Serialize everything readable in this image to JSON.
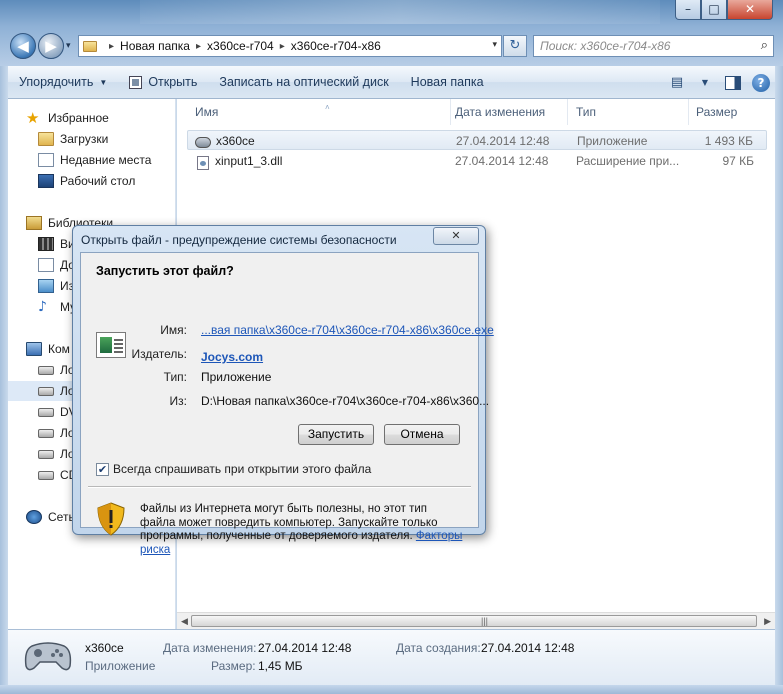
{
  "window": {
    "min_label": "–",
    "max_label": "□",
    "close_label": "✕"
  },
  "nav": {
    "back": "◀",
    "forward": "▶",
    "dropdown": "▾"
  },
  "address": {
    "crumbs": [
      "Новая папка",
      "x360ce-r704",
      "x360ce-r704-x86"
    ],
    "separator": "▸",
    "dropdown": "▾"
  },
  "refresh_icon": "↻",
  "search": {
    "placeholder": "Поиск: x360ce-r704-x86",
    "icon": "⌕"
  },
  "toolbar": {
    "organize": "Упорядочить",
    "open": "Открыть",
    "burn": "Записать на оптический диск",
    "new_folder": "Новая папка",
    "caret": "▼",
    "view_icon": "▤",
    "help": "?"
  },
  "sidebar": {
    "favorites": {
      "label": "Избранное",
      "items": [
        "Загрузки",
        "Недавние места",
        "Рабочий стол"
      ]
    },
    "libraries": {
      "label": "Библиотеки",
      "items": [
        "Ви",
        "До",
        "Из",
        "Му"
      ]
    },
    "computer": {
      "label": "Ком",
      "items": [
        "Ло",
        "Ло",
        "DV",
        "Ло",
        "Ло",
        "CD"
      ]
    },
    "network": {
      "label": "Сеть"
    }
  },
  "columns": {
    "name": "Имя",
    "date": "Дата изменения",
    "type": "Тип",
    "size": "Размер",
    "sort_arrow": "˄"
  },
  "files": [
    {
      "name": "x360ce",
      "date": "27.04.2014 12:48",
      "type": "Приложение",
      "size": "1 493 КБ"
    },
    {
      "name": "xinput1_3.dll",
      "date": "27.04.2014 12:48",
      "type": "Расширение при...",
      "size": "97 КБ"
    }
  ],
  "scroll": {
    "left": "◀",
    "right": "▶",
    "grip": "|||"
  },
  "details": {
    "name": "x360ce",
    "kind": "Приложение",
    "modified_label": "Дата изменения:",
    "modified_value": "27.04.2014 12:48",
    "size_label": "Размер:",
    "size_value": "1,45 МБ",
    "created_label": "Дата создания:",
    "created_value": "27.04.2014 12:48"
  },
  "dialog": {
    "title": "Открыть файл - предупреждение системы безопасности",
    "close": "✕",
    "heading": "Запустить этот файл?",
    "name_label": "Имя:",
    "name_value": "...вая папка\\x360ce-r704\\x360ce-r704-x86\\x360ce.exe",
    "publisher_label": "Издатель:",
    "publisher_value": "Jocys.com",
    "type_label": "Тип:",
    "type_value": "Приложение",
    "from_label": "Из:",
    "from_value": "D:\\Новая папка\\x360ce-r704\\x360ce-r704-x86\\x360...",
    "run_button": "Запустить",
    "cancel_button": "Отмена",
    "always_ask": "Всегда спрашивать при открытии этого файла",
    "always_ask_checked": true,
    "check_mark": "✔",
    "warning_text": "Файлы из Интернета могут быть полезны, но этот тип файла может повредить компьютер. Запускайте только программы, полученные от доверяемого издателя.",
    "risk_link": "Факторы риска"
  }
}
